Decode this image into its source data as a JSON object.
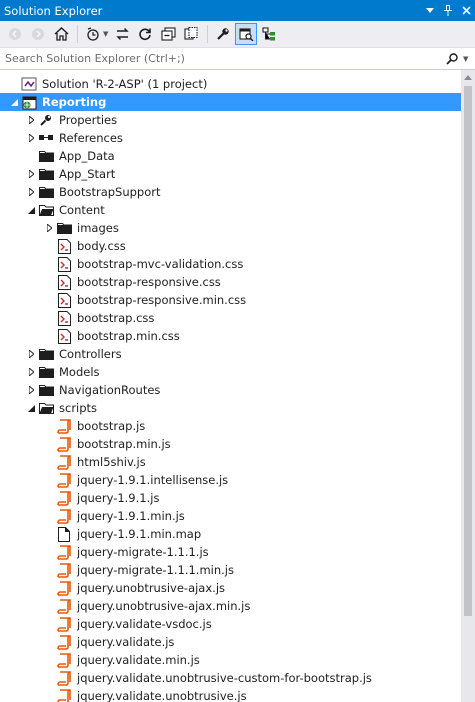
{
  "window": {
    "title": "Solution Explorer"
  },
  "titlebar": {
    "pin_icon": "pin-icon",
    "close_icon": "close-icon",
    "dropdown_icon": "window-position-icon"
  },
  "toolbar": {
    "buttons": [
      "back-icon",
      "forward-icon",
      "home-icon",
      "pending-changes-filter-icon",
      "sync-with-active-document-icon",
      "refresh-icon",
      "collapse-all-icon",
      "show-all-files-icon",
      "properties-icon",
      "preview-selected-items-icon",
      "class-view-icon"
    ]
  },
  "search": {
    "placeholder": "Search Solution Explorer (Ctrl+;)",
    "value": ""
  },
  "tree": {
    "solution": "Solution 'R-2-ASP' (1 project)",
    "project": "Reporting",
    "items": {
      "properties": "Properties",
      "references": "References",
      "app_data": "App_Data",
      "app_start": "App_Start",
      "bootstrap_support": "BootstrapSupport",
      "content": "Content",
      "images": "images",
      "body_css": "body.css",
      "bs_mvc_validation_css": "bootstrap-mvc-validation.css",
      "bs_responsive_css": "bootstrap-responsive.css",
      "bs_responsive_min_css": "bootstrap-responsive.min.css",
      "bs_css": "bootstrap.css",
      "bs_min_css": "bootstrap.min.css",
      "controllers": "Controllers",
      "models": "Models",
      "navigation_routes": "NavigationRoutes",
      "scripts": "scripts",
      "bootstrap_js": "bootstrap.js",
      "bootstrap_min_js": "bootstrap.min.js",
      "html5shiv_js": "html5shiv.js",
      "jquery_intellisense_js": "jquery-1.9.1.intellisense.js",
      "jquery_js": "jquery-1.9.1.js",
      "jquery_min_js": "jquery-1.9.1.min.js",
      "jquery_min_map": "jquery-1.9.1.min.map",
      "jquery_migrate_js": "jquery-migrate-1.1.1.js",
      "jquery_migrate_min_js": "jquery-migrate-1.1.1.min.js",
      "unobtrusive_ajax_js": "jquery.unobtrusive-ajax.js",
      "unobtrusive_ajax_min_js": "jquery.unobtrusive-ajax.min.js",
      "validate_vsdoc_js": "jquery.validate-vsdoc.js",
      "validate_js": "jquery.validate.js",
      "validate_min_js": "jquery.validate.min.js",
      "validate_unobtrusive_bootstrap_js": "jquery.validate.unobtrusive-custom-for-bootstrap.js",
      "validate_unobtrusive_js": "jquery.validate.unobtrusive.js"
    }
  },
  "colors": {
    "accent": "#007acc",
    "selection": "#3399ff",
    "folder": "#dcb67a",
    "js_file": "#e8590c",
    "css_file": "#c9302c"
  }
}
